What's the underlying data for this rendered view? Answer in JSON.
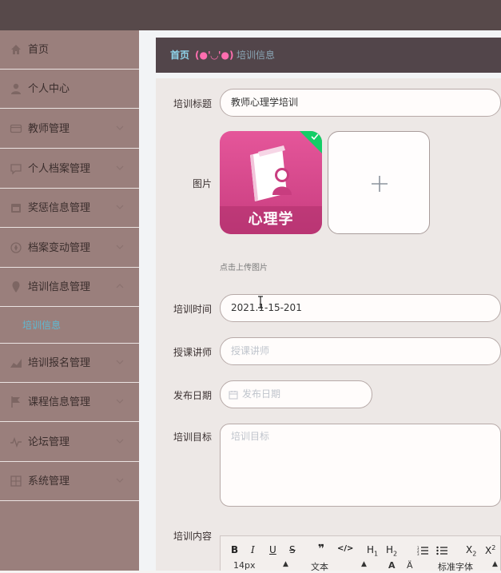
{
  "sidebar": {
    "items": [
      {
        "label": "首页",
        "icon": "home-icon"
      },
      {
        "label": "个人中心",
        "icon": "user-icon"
      },
      {
        "label": "教师管理",
        "icon": "card-icon"
      },
      {
        "label": "个人档案管理",
        "icon": "chat-icon"
      },
      {
        "label": "奖惩信息管理",
        "icon": "calendar-icon"
      },
      {
        "label": "档案变动管理",
        "icon": "compass-icon"
      },
      {
        "label": "培训信息管理",
        "icon": "pin-icon"
      },
      {
        "label": "培训报名管理",
        "icon": "chart-icon"
      },
      {
        "label": "课程信息管理",
        "icon": "flag-icon"
      },
      {
        "label": "论坛管理",
        "icon": "pulse-icon"
      },
      {
        "label": "系统管理",
        "icon": "grid-icon"
      }
    ],
    "sub_item": "培训信息"
  },
  "breadcrumb": {
    "home": "首页",
    "emoji": "(●'◡'●)",
    "current": "培训信息"
  },
  "form": {
    "title_label": "培训标题",
    "title_value": "教师心理学培训",
    "image_label": "图片",
    "image_text": "心理学",
    "upload_hint": "点击上传图片",
    "time_label": "培训时间",
    "time_value": "2021.1-15-201",
    "teacher_label": "授课讲师",
    "teacher_placeholder": "授课讲师",
    "date_label": "发布日期",
    "date_placeholder": "发布日期",
    "goal_label": "培训目标",
    "goal_placeholder": "培训目标",
    "content_label": "培训内容"
  },
  "editor": {
    "font_size": "14px",
    "paragraph": "文本",
    "font_family": "标准字体"
  },
  "colors": {
    "topbar": "#57494a",
    "sidebar": "#9a7f7c",
    "breadcrumb_bg": "#52454a",
    "accent_blue": "#8fd4ea",
    "accent_pink": "#ff6eb0",
    "image_tile": "#d9478a",
    "success_badge": "#13ce66"
  }
}
